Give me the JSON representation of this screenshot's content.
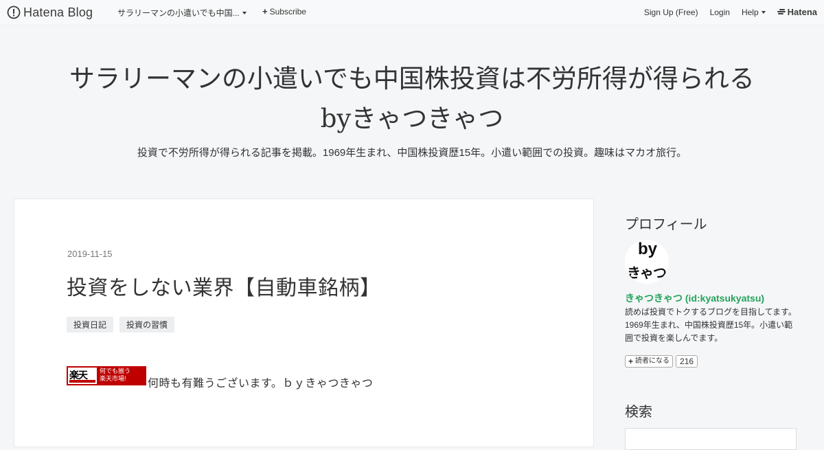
{
  "navbar": {
    "logo_text": "Hatena Blog",
    "blog_menu_label": "サラリーマンの小遣いでも中国...",
    "subscribe_label": "Subscribe",
    "signup_label": "Sign Up (Free)",
    "login_label": "Login",
    "help_label": "Help",
    "hatena_label": "Hatena"
  },
  "header": {
    "title_line1": "サラリーマンの小遣いでも中国株投資は不労所得が得られる",
    "title_line2": "byきゃつきゃつ",
    "description": "投資で不労所得が得られる記事を掲載。1969年生まれ、中国株投資歴15年。小遣い範囲での投資。趣味はマカオ旅行。"
  },
  "entry": {
    "date": "2019-11-15",
    "title": "投資をしない業界【自動車銘柄】",
    "categories": [
      "投資日記",
      "投資の習慣"
    ],
    "banner": {
      "kanji": "楽天",
      "line1": "何でも揃う",
      "line2": "楽天市場!"
    },
    "body_text": "何時も有難うございます。ｂｙきゃつきゃつ"
  },
  "sidebar": {
    "profile_heading": "プロフィール",
    "avatar_text_top": "by",
    "avatar_text_bottom": "きゃつ",
    "profile_name": "きゃつきゃつ (id:kyatsukyatsu)",
    "profile_description": "読めば投資でトクするブログを目指してます。1969年生まれ、中国株投資歴15年。小遣い範囲で投資を楽しんでます。",
    "reader_button_label": "読者になる",
    "reader_count": "216",
    "search_heading": "検索"
  },
  "colors": {
    "page_bg": "#f4f6f8",
    "profile_name": "#25a25a",
    "rakuten_red": "#bf0000"
  }
}
